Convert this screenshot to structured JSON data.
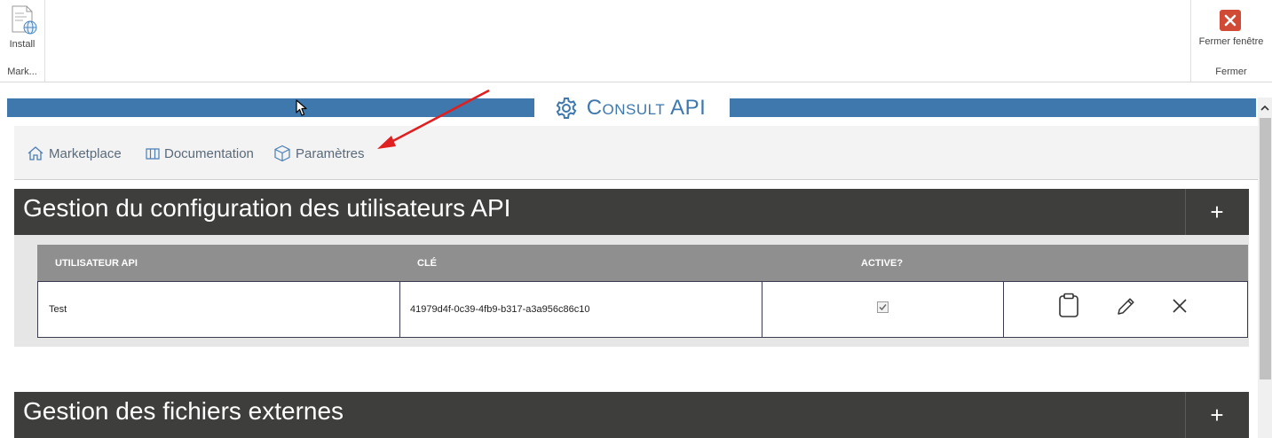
{
  "ribbon": {
    "install_label": "Install",
    "left_group_label": "Mark...",
    "close_label": "Fermer fenêtre",
    "right_group_label": "Fermer"
  },
  "header": {
    "title": "Consult API"
  },
  "nav": [
    {
      "label": "Marketplace",
      "icon": "home-icon"
    },
    {
      "label": "Documentation",
      "icon": "book-icon"
    },
    {
      "label": "Paramètres",
      "icon": "cube-icon"
    }
  ],
  "section1": {
    "title": "Gestion du configuration des utilisateurs API",
    "plus": "+",
    "columns": [
      "UTILISATEUR API",
      "CLÉ",
      "ACTIVE?"
    ],
    "rows": [
      {
        "user": "Test",
        "key": "41979d4f-0c39-4fb9-b317-a3a956c86c10",
        "active": true
      }
    ]
  },
  "section2": {
    "title": "Gestion des fichiers externes",
    "plus": "+"
  },
  "colors": {
    "accent": "#3e78ad",
    "header_bg": "#3e3e3c",
    "close_red": "#d04a36",
    "annotation_arrow": "#e02020"
  }
}
